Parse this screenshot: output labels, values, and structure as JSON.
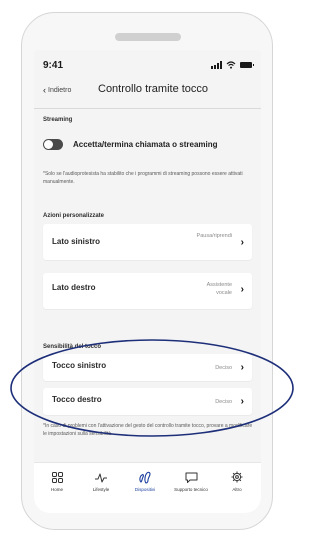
{
  "status_bar": {
    "time": "9:41"
  },
  "header": {
    "back_label": "Indietro",
    "title": "Controllo tramite tocco"
  },
  "streaming": {
    "section_title": "Streaming",
    "toggle_label": "Accetta/termina chiamata o streaming",
    "toggle_on": false,
    "note": "*Solo se l'audioprotesista ha stabilito che i programmi di streaming possono essere attivati manualmente."
  },
  "custom_actions": {
    "section_title": "Azioni personalizzate",
    "items": [
      {
        "label": "Lato sinistro",
        "value": "Pausa/riprendi"
      },
      {
        "label": "Lato destro",
        "value_line1": "Assistente",
        "value_line2": "vocale"
      }
    ]
  },
  "sensitivity": {
    "section_title": "Sensibilità del tocco",
    "items": [
      {
        "label": "Tocco sinistro",
        "value": "Deciso"
      },
      {
        "label": "Tocco destro",
        "value": "Deciso"
      }
    ],
    "note": "*In caso di problemi con l'attivazione del gesto del controllo tramite tocco, provare a modificare le impostazioni sulla sensibilità."
  },
  "tab_bar": {
    "active_tab": "Dispositivi",
    "tabs": [
      {
        "label": "Home",
        "icon": "grid-icon"
      },
      {
        "label": "Lifestyle",
        "icon": "activity-icon"
      },
      {
        "label": "Dispositivi",
        "icon": "hearing-aids-icon"
      },
      {
        "label": "Supporto tecnico",
        "icon": "chat-bubble-icon"
      },
      {
        "label": "Altro",
        "icon": "gear-icon"
      }
    ]
  },
  "colors": {
    "accent": "#1a3d9e",
    "highlight_ring": "#1e2f7a",
    "toggle_off": "#4a4a4a"
  }
}
